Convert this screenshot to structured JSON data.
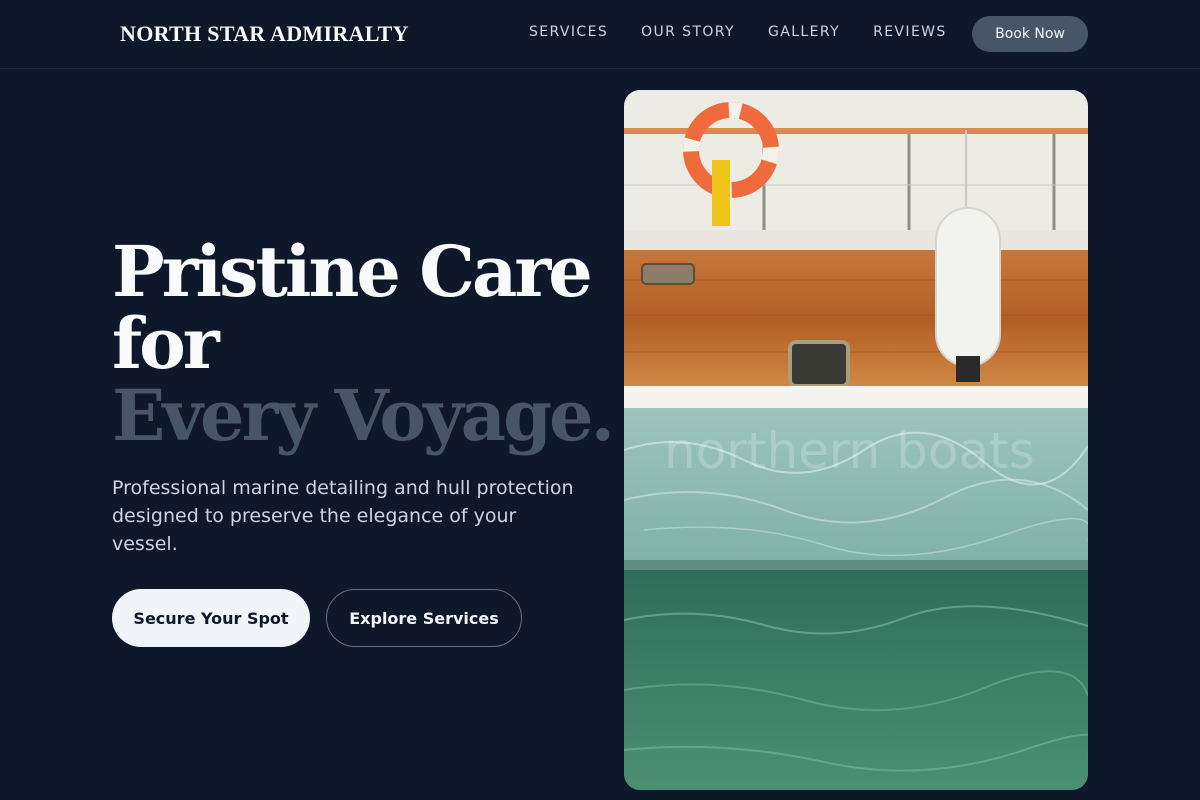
{
  "nav": {
    "brand": "NORTH STAR ADMIRALTY",
    "links": [
      "SERVICES",
      "OUR STORY",
      "GALLERY",
      "REVIEWS"
    ],
    "cta": "Book Now"
  },
  "hero": {
    "headline_line1": "Pristine Care",
    "headline_line2": "for",
    "headline_line3": "Every Voyage.",
    "subtitle": "Professional marine detailing and hull protection designed to preserve the elegance of your vessel.",
    "primary_button": "Secure Your Spot",
    "secondary_button": "Explore Services",
    "image_watermark": "northern boats"
  },
  "colors": {
    "background": "#0f172a",
    "accent_muted": "#475569",
    "text_light": "#f1f5f9"
  }
}
